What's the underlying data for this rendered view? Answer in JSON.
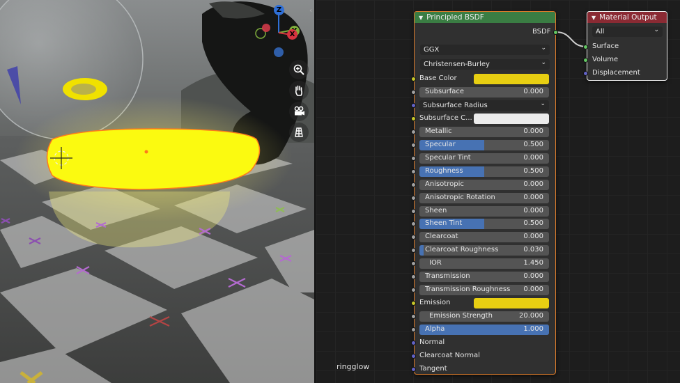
{
  "viewport": {
    "gizmo": {
      "z": "Z",
      "y": "Y",
      "x": "X"
    },
    "nav_tools": [
      "zoom-icon",
      "hand-icon",
      "camera-icon",
      "grid-icon"
    ]
  },
  "node_editor": {
    "object_label": "ringglow",
    "principled": {
      "title": "Principled BSDF",
      "output": "BSDF",
      "distribution": "GGX",
      "subsurface_method": "Christensen-Burley",
      "inputs": [
        {
          "name": "Base Color",
          "kind": "color",
          "socket": "yellow",
          "color": "#e8cf12"
        },
        {
          "name": "Subsurface",
          "kind": "value",
          "value": "0.000",
          "fill": 0,
          "socket": "gray"
        },
        {
          "name": "Subsurface Radius",
          "kind": "menu",
          "socket": "blue"
        },
        {
          "name": "Subsurface C...",
          "kind": "color",
          "socket": "yellow",
          "color": "#ececec"
        },
        {
          "name": "Metallic",
          "kind": "value",
          "value": "0.000",
          "fill": 0,
          "socket": "gray"
        },
        {
          "name": "Specular",
          "kind": "value",
          "value": "0.500",
          "fill": 0.5,
          "socket": "gray"
        },
        {
          "name": "Specular Tint",
          "kind": "value",
          "value": "0.000",
          "fill": 0,
          "socket": "gray"
        },
        {
          "name": "Roughness",
          "kind": "value",
          "value": "0.500",
          "fill": 0.5,
          "socket": "gray"
        },
        {
          "name": "Anisotropic",
          "kind": "value",
          "value": "0.000",
          "fill": 0,
          "socket": "gray"
        },
        {
          "name": "Anisotropic Rotation",
          "kind": "value",
          "value": "0.000",
          "fill": 0,
          "socket": "gray"
        },
        {
          "name": "Sheen",
          "kind": "value",
          "value": "0.000",
          "fill": 0,
          "socket": "gray"
        },
        {
          "name": "Sheen Tint",
          "kind": "value",
          "value": "0.500",
          "fill": 0.5,
          "socket": "gray"
        },
        {
          "name": "Clearcoat",
          "kind": "value",
          "value": "0.000",
          "fill": 0,
          "socket": "gray"
        },
        {
          "name": "Clearcoat Roughness",
          "kind": "value",
          "value": "0.030",
          "fill": 0.03,
          "socket": "gray"
        },
        {
          "name": "IOR",
          "kind": "value",
          "value": "1.450",
          "fill": 0,
          "socket": "gray"
        },
        {
          "name": "Transmission",
          "kind": "value",
          "value": "0.000",
          "fill": 0,
          "socket": "gray"
        },
        {
          "name": "Transmission Roughness",
          "kind": "value",
          "value": "0.000",
          "fill": 0,
          "socket": "gray"
        },
        {
          "name": "Emission",
          "kind": "color",
          "socket": "yellow",
          "color": "#e8cf12"
        },
        {
          "name": "Emission Strength",
          "kind": "value",
          "value": "20.000",
          "fill": 0,
          "socket": "gray"
        },
        {
          "name": "Alpha",
          "kind": "value",
          "value": "1.000",
          "fill": 1,
          "socket": "gray"
        },
        {
          "name": "Normal",
          "kind": "socket",
          "socket": "blue"
        },
        {
          "name": "Clearcoat Normal",
          "kind": "socket",
          "socket": "blue"
        },
        {
          "name": "Tangent",
          "kind": "socket",
          "socket": "blue"
        }
      ]
    },
    "material_output": {
      "title": "Material Output",
      "target": "All",
      "inputs": [
        "Surface",
        "Volume",
        "Displacement"
      ]
    }
  }
}
